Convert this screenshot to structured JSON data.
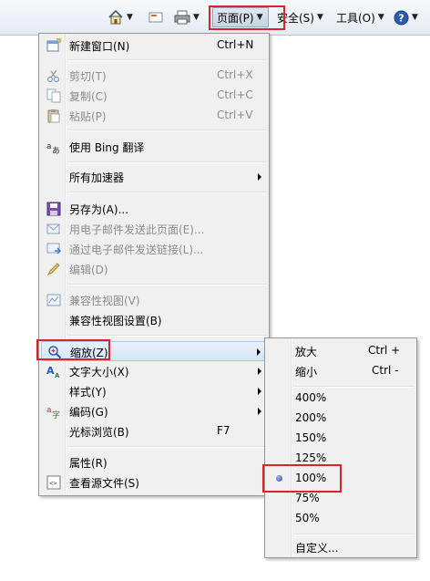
{
  "toolbar": {
    "items": [
      {
        "name": "home-button",
        "icon": "home-icon"
      },
      {
        "name": "feeds-button",
        "icon": "feeds-icon"
      },
      {
        "name": "print-button",
        "icon": "print-icon"
      },
      {
        "name": "page-menu",
        "label": "页面(P)"
      },
      {
        "name": "safety-menu",
        "label": "安全(S)"
      },
      {
        "name": "tools-menu",
        "label": "工具(O)"
      },
      {
        "name": "help-button",
        "icon": "help-icon"
      }
    ]
  },
  "page_menu": {
    "items": [
      {
        "label": "新建窗口(N)",
        "shortcut": "Ctrl+N",
        "icon": "new-window-icon",
        "enabled": true
      },
      {
        "label": "剪切(T)",
        "shortcut": "Ctrl+X",
        "icon": "cut-icon",
        "enabled": false
      },
      {
        "label": "复制(C)",
        "shortcut": "Ctrl+C",
        "icon": "copy-icon",
        "enabled": false
      },
      {
        "label": "粘贴(P)",
        "shortcut": "Ctrl+V",
        "icon": "paste-icon",
        "enabled": false
      },
      {
        "label": "使用 Bing 翻译",
        "icon": "translate-icon",
        "enabled": true
      },
      {
        "label": "所有加速器",
        "enabled": true,
        "submenu": true
      },
      {
        "label": "另存为(A)...",
        "icon": "save-as-icon",
        "enabled": true
      },
      {
        "label": "用电子邮件发送此页面(E)...",
        "icon": "email-page-icon",
        "enabled": false
      },
      {
        "label": "通过电子邮件发送链接(L)...",
        "icon": "email-link-icon",
        "enabled": false
      },
      {
        "label": "编辑(D)",
        "icon": "edit-icon",
        "enabled": false
      },
      {
        "label": "兼容性视图(V)",
        "icon": "compat-view-icon",
        "enabled": false
      },
      {
        "label": "兼容性视图设置(B)",
        "enabled": true
      },
      {
        "label": "缩放(Z)",
        "icon": "zoom-icon",
        "enabled": true,
        "submenu": true,
        "highlighted": true
      },
      {
        "label": "文字大小(X)",
        "icon": "text-size-icon",
        "enabled": true,
        "submenu": true
      },
      {
        "label": "样式(Y)",
        "enabled": true,
        "submenu": true
      },
      {
        "label": "编码(G)",
        "icon": "encoding-icon",
        "enabled": true,
        "submenu": true
      },
      {
        "label": "光标浏览(B)",
        "shortcut": "F7",
        "enabled": true
      },
      {
        "label": "属性(R)",
        "enabled": true
      },
      {
        "label": "查看源文件(S)",
        "icon": "view-source-icon",
        "enabled": true
      }
    ]
  },
  "zoom_submenu": {
    "items": [
      {
        "label": "放大",
        "shortcut": "Ctrl +"
      },
      {
        "label": "缩小",
        "shortcut": "Ctrl -"
      },
      {
        "label": "400%"
      },
      {
        "label": "200%"
      },
      {
        "label": "150%"
      },
      {
        "label": "125%"
      },
      {
        "label": "100%",
        "selected": true
      },
      {
        "label": "75%"
      },
      {
        "label": "50%"
      },
      {
        "label": "自定义..."
      }
    ]
  },
  "colors": {
    "highlight_box": "#d9232e",
    "menu_bg": "#f0f0f0",
    "disabled_text": "#8d8d8d"
  }
}
